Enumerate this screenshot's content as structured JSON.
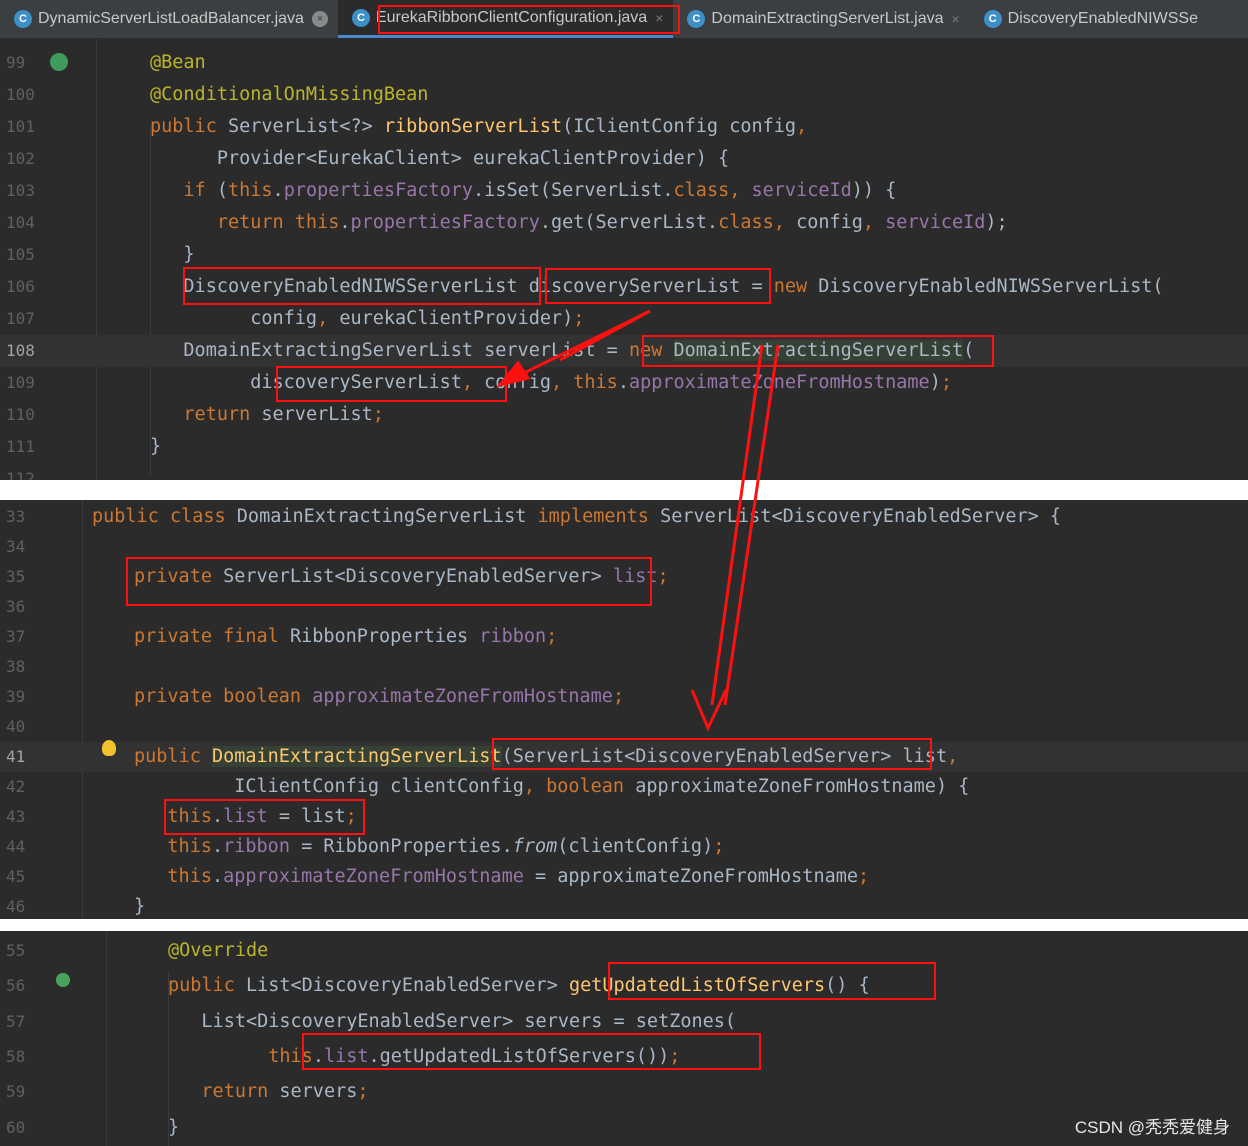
{
  "tabs": [
    {
      "label": "DynamicServerListLoadBalancer.java",
      "icon": "C"
    },
    {
      "label": "EurekaRibbonClientConfiguration.java",
      "icon": "C"
    },
    {
      "label": "DomainExtractingServerList.java",
      "icon": "C"
    },
    {
      "label": "DiscoveryEnabledNIWSSe",
      "icon": "C"
    }
  ],
  "panel1": {
    "line_numbers": [
      "99",
      "100",
      "101",
      "102",
      "103",
      "104",
      "105",
      "106",
      "107",
      "108",
      "109",
      "110",
      "111",
      "112"
    ],
    "lines": [
      [
        {
          "t": "@Bean",
          "c": "ann"
        }
      ],
      [
        {
          "t": "@ConditionalOnMissingBean",
          "c": "ann"
        }
      ],
      [
        {
          "t": "public ",
          "c": "kw"
        },
        {
          "t": "ServerList<?> "
        },
        {
          "t": "ribbonServerList",
          "c": "fn"
        },
        {
          "t": "(IClientConfig config"
        },
        {
          "t": ",",
          "c": "kw"
        }
      ],
      [
        {
          "t": "      Provider<EurekaClient> eurekaClientProvider) {"
        }
      ],
      [
        {
          "t": "   "
        },
        {
          "t": "if ",
          "c": "kw"
        },
        {
          "t": "("
        },
        {
          "t": "this",
          "c": "kw"
        },
        {
          "t": "."
        },
        {
          "t": "propertiesFactory",
          "c": "fld"
        },
        {
          "t": ".isSet(ServerList."
        },
        {
          "t": "class",
          "c": "kw"
        },
        {
          "t": ", ",
          "c": "kw"
        },
        {
          "t": "serviceId",
          "c": "fld"
        },
        {
          "t": ")) {"
        }
      ],
      [
        {
          "t": "      "
        },
        {
          "t": "return this",
          "c": "kw"
        },
        {
          "t": "."
        },
        {
          "t": "propertiesFactory",
          "c": "fld"
        },
        {
          "t": ".get(ServerList."
        },
        {
          "t": "class",
          "c": "kw"
        },
        {
          "t": ", ",
          "c": "kw"
        },
        {
          "t": "config"
        },
        {
          "t": ", ",
          "c": "kw"
        },
        {
          "t": "serviceId",
          "c": "fld"
        },
        {
          "t": ");"
        }
      ],
      [
        {
          "t": "   }"
        }
      ],
      [
        {
          "t": "   DiscoveryEnabledNIWSServerList discoveryServerList = "
        },
        {
          "t": "new ",
          "c": "kw"
        },
        {
          "t": "DiscoveryEnabledNIWSServerList("
        }
      ],
      [
        {
          "t": "         config"
        },
        {
          "t": ", ",
          "c": "kw"
        },
        {
          "t": "eurekaClientProvider)"
        },
        {
          "t": ";",
          "c": "kw"
        }
      ],
      [
        {
          "t": "   DomainExtractingServerList serverList = "
        },
        {
          "t": "new ",
          "c": "kw"
        },
        {
          "t": "DomainExtractingServerList",
          "c": "hl"
        },
        {
          "t": "("
        }
      ],
      [
        {
          "t": "         discoveryServerList"
        },
        {
          "t": ", ",
          "c": "kw"
        },
        {
          "t": "config"
        },
        {
          "t": ", ",
          "c": "kw"
        },
        {
          "t": "this",
          "c": "kw"
        },
        {
          "t": "."
        },
        {
          "t": "approximateZoneFromHostname",
          "c": "fld"
        },
        {
          "t": ")"
        },
        {
          "t": ";",
          "c": "kw"
        }
      ],
      [
        {
          "t": "   "
        },
        {
          "t": "return ",
          "c": "kw"
        },
        {
          "t": "serverList"
        },
        {
          "t": ";",
          "c": "kw"
        }
      ],
      [
        {
          "t": "}"
        }
      ],
      [
        {
          "t": ""
        }
      ]
    ]
  },
  "panel2": {
    "line_numbers": [
      "33",
      "34",
      "35",
      "36",
      "37",
      "38",
      "39",
      "40",
      "41",
      "42",
      "43",
      "44",
      "45",
      "46"
    ],
    "lines": [
      [
        {
          "t": "public class ",
          "c": "kw"
        },
        {
          "t": "DomainExtractingServerList "
        },
        {
          "t": "implements ",
          "c": "kw"
        },
        {
          "t": "ServerList<DiscoveryEnabledServer> {"
        }
      ],
      [
        {
          "t": ""
        }
      ],
      [
        {
          "t": "private ",
          "c": "kw"
        },
        {
          "t": "ServerList<DiscoveryEnabledServer> "
        },
        {
          "t": "list",
          "c": "fld"
        },
        {
          "t": ";",
          "c": "kw"
        }
      ],
      [
        {
          "t": ""
        }
      ],
      [
        {
          "t": "private final ",
          "c": "kw"
        },
        {
          "t": "RibbonProperties "
        },
        {
          "t": "ribbon",
          "c": "fld"
        },
        {
          "t": ";",
          "c": "kw"
        }
      ],
      [
        {
          "t": ""
        }
      ],
      [
        {
          "t": "private boolean ",
          "c": "kw"
        },
        {
          "t": "approximateZoneFromHostname",
          "c": "fld"
        },
        {
          "t": ";",
          "c": "kw"
        }
      ],
      [
        {
          "t": ""
        }
      ],
      [
        {
          "t": "public ",
          "c": "kw"
        },
        {
          "t": "DomainExtractingServerList",
          "c": "fn hl"
        },
        {
          "t": "(ServerList<DiscoveryEnabledServer> list"
        },
        {
          "t": ",",
          "c": "kw"
        }
      ],
      [
        {
          "t": "         IClientConfig clientConfig"
        },
        {
          "t": ", ",
          "c": "kw"
        },
        {
          "t": "boolean ",
          "c": "kw"
        },
        {
          "t": "approximateZoneFromHostname) {"
        }
      ],
      [
        {
          "t": "   "
        },
        {
          "t": "this",
          "c": "kw"
        },
        {
          "t": "."
        },
        {
          "t": "list",
          "c": "fld"
        },
        {
          "t": " = list"
        },
        {
          "t": ";",
          "c": "kw"
        }
      ],
      [
        {
          "t": "   "
        },
        {
          "t": "this",
          "c": "kw"
        },
        {
          "t": "."
        },
        {
          "t": "ribbon",
          "c": "fld"
        },
        {
          "t": " = RibbonProperties."
        },
        {
          "t": "from",
          "c": "it"
        },
        {
          "t": "(clientConfig)"
        },
        {
          "t": ";",
          "c": "kw"
        }
      ],
      [
        {
          "t": "   "
        },
        {
          "t": "this",
          "c": "kw"
        },
        {
          "t": "."
        },
        {
          "t": "approximateZoneFromHostname",
          "c": "fld"
        },
        {
          "t": " = approximateZoneFromHostname"
        },
        {
          "t": ";",
          "c": "kw"
        }
      ],
      [
        {
          "t": "}"
        }
      ]
    ]
  },
  "panel3": {
    "line_numbers": [
      "55",
      "56",
      "57",
      "58",
      "59",
      "60"
    ],
    "lines": [
      [
        {
          "t": "@Override",
          "c": "ann"
        }
      ],
      [
        {
          "t": "public ",
          "c": "kw"
        },
        {
          "t": "List<DiscoveryEnabledServer> "
        },
        {
          "t": "getUpdatedListOfServers",
          "c": "fn"
        },
        {
          "t": "() {"
        }
      ],
      [
        {
          "t": "   List<DiscoveryEnabledServer> servers = setZones("
        }
      ],
      [
        {
          "t": "         "
        },
        {
          "t": "this",
          "c": "kw"
        },
        {
          "t": "."
        },
        {
          "t": "list",
          "c": "fld"
        },
        {
          "t": ".getUpdatedListOfServers())"
        },
        {
          "t": ";",
          "c": "kw"
        }
      ],
      [
        {
          "t": "   "
        },
        {
          "t": "return ",
          "c": "kw"
        },
        {
          "t": "servers"
        },
        {
          "t": ";",
          "c": "kw"
        }
      ],
      [
        {
          "t": "}"
        }
      ]
    ]
  },
  "watermark": "CSDN @秃秃爱健身",
  "colors": {
    "bg": "#2b2b2b",
    "keyword": "#cc7832",
    "annotation": "#bbb529",
    "method": "#ffc66d",
    "field": "#9876aa",
    "text": "#a9b7c6",
    "highlight_box": "#ff1010"
  }
}
